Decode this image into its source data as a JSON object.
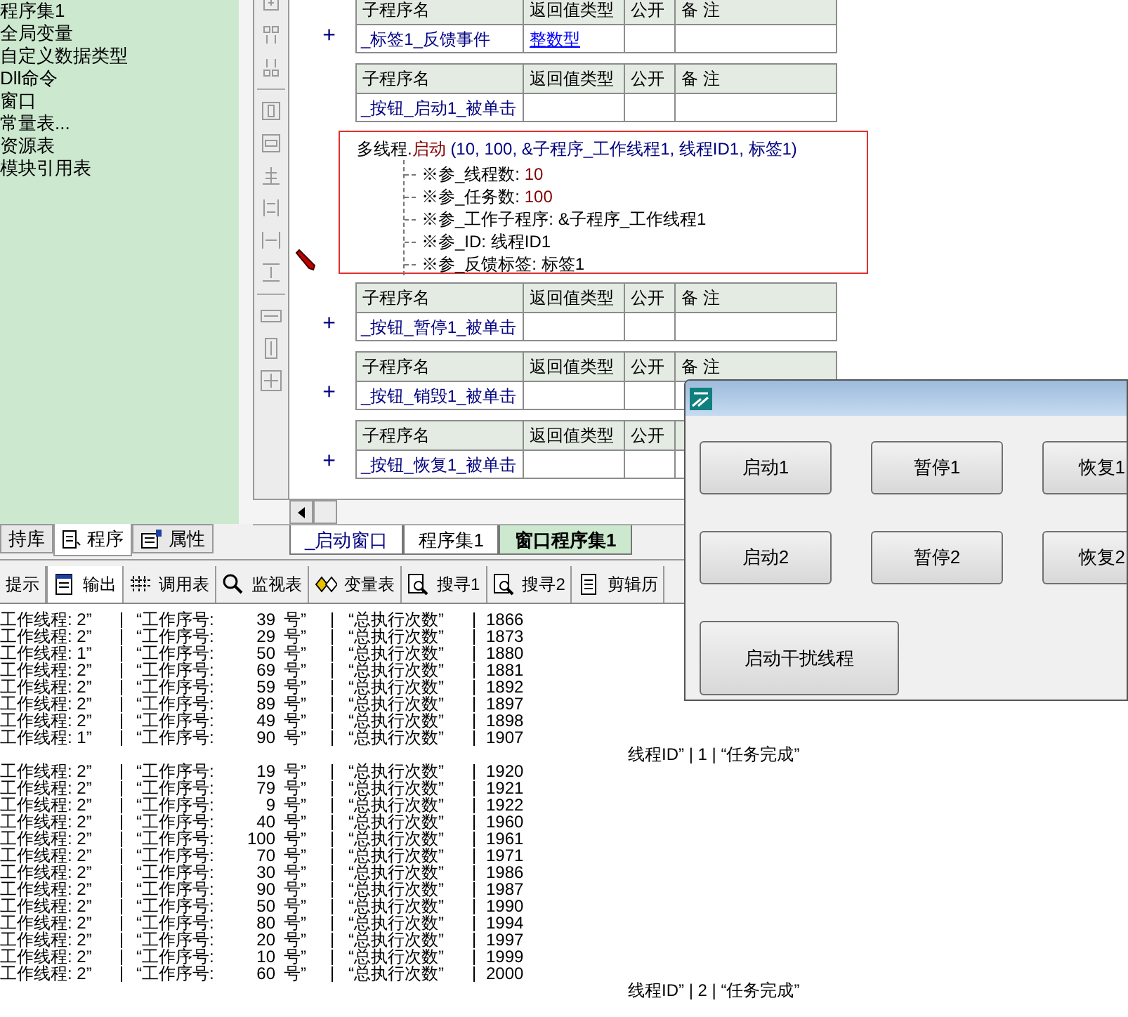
{
  "project_tree": {
    "items": [
      "程序集1",
      "全局变量",
      "自定义数据类型",
      "Dll命令",
      "窗口",
      "常量表...",
      "资源表",
      "模块引用表"
    ]
  },
  "left_tabs": [
    {
      "label": "持库",
      "selected": false
    },
    {
      "label": "程序",
      "selected": true
    },
    {
      "label": "属性",
      "selected": false
    }
  ],
  "code": {
    "blocks": [
      {
        "kind": "subroutine",
        "headers": [
          "子程序名",
          "返回值类型",
          "公开",
          "备 注"
        ],
        "name": "_标签1_反馈事件",
        "return_type": "整数型",
        "expanded": false,
        "marker": "+"
      },
      {
        "kind": "subroutine",
        "headers": [
          "子程序名",
          "返回值类型",
          "公开",
          "备 注"
        ],
        "name": "_按钮_启动1_被单击"
      },
      {
        "kind": "call",
        "object": "多线程.",
        "method": "启动",
        "args": "(10, 100, &子程序_工作线程1, 线程ID1, 标签1)",
        "highlighted": true,
        "current": true,
        "params": [
          {
            "name": "※参_线程数:",
            "value": "10",
            "kind": "constant"
          },
          {
            "name": "※参_任务数:",
            "value": "100",
            "kind": "constant"
          },
          {
            "name": "※参_工作子程序:",
            "value": "&子程序_工作线程1",
            "kind": "reference"
          },
          {
            "name": "※参_ID:",
            "value": "线程ID1",
            "kind": "reference"
          },
          {
            "name": "※参_反馈标签:",
            "value": "标签1",
            "kind": "reference"
          }
        ]
      },
      {
        "kind": "subroutine",
        "headers": [
          "子程序名",
          "返回值类型",
          "公开",
          "备 注"
        ],
        "name": "_按钮_暂停1_被单击",
        "expanded": false,
        "marker": "+"
      },
      {
        "kind": "subroutine",
        "headers": [
          "子程序名",
          "返回值类型",
          "公开",
          "备 注"
        ],
        "name": "_按钮_销毁1_被单击",
        "expanded": false,
        "marker": "+"
      },
      {
        "kind": "subroutine",
        "headers": [
          "子程序名",
          "返回值类型",
          "公开"
        ],
        "name": "_按钮_恢复1_被单击",
        "expanded": false,
        "marker": "+"
      }
    ]
  },
  "code_tabs": [
    {
      "label": "_启动窗口",
      "kind": "window",
      "selected": false
    },
    {
      "label": "程序集1",
      "kind": "module",
      "selected": false
    },
    {
      "label": "窗口程序集1",
      "kind": "module",
      "selected": true
    }
  ],
  "output_tabs": [
    {
      "label": "提示",
      "selected": false
    },
    {
      "label": "输出",
      "selected": true
    },
    {
      "label": "调用表",
      "selected": false
    },
    {
      "label": "监视表",
      "selected": false
    },
    {
      "label": "变量表",
      "selected": false
    },
    {
      "label": "搜寻1",
      "selected": false
    },
    {
      "label": "搜寻2",
      "selected": false
    },
    {
      "label": "剪辑历",
      "selected": false
    }
  ],
  "output_lines": [
    {
      "kind": "record",
      "thread": "工作线程: 2”",
      "seq": "“工作序号:",
      "number": "39",
      "unit": "号”",
      "total": "“总执行次数”",
      "count": "1866"
    },
    {
      "kind": "record",
      "thread": "工作线程: 2”",
      "seq": "“工作序号:",
      "number": "29",
      "unit": "号”",
      "total": "“总执行次数”",
      "count": "1873"
    },
    {
      "kind": "record",
      "thread": "工作线程: 1”",
      "seq": "“工作序号:",
      "number": "50",
      "unit": "号”",
      "total": "“总执行次数”",
      "count": "1880"
    },
    {
      "kind": "record",
      "thread": "工作线程: 2”",
      "seq": "“工作序号:",
      "number": "69",
      "unit": "号”",
      "total": "“总执行次数”",
      "count": "1881"
    },
    {
      "kind": "record",
      "thread": "工作线程: 2”",
      "seq": "“工作序号:",
      "number": "59",
      "unit": "号”",
      "total": "“总执行次数”",
      "count": "1892"
    },
    {
      "kind": "record",
      "thread": "工作线程: 2”",
      "seq": "“工作序号:",
      "number": "89",
      "unit": "号”",
      "total": "“总执行次数”",
      "count": "1897"
    },
    {
      "kind": "record",
      "thread": "工作线程: 2”",
      "seq": "“工作序号:",
      "number": "49",
      "unit": "号”",
      "total": "“总执行次数”",
      "count": "1898"
    },
    {
      "kind": "record",
      "thread": "工作线程: 1”",
      "seq": "“工作序号:",
      "number": "90",
      "unit": "号”",
      "total": "“总执行次数”",
      "count": "1907"
    },
    {
      "kind": "done",
      "text": "线程ID” | 1 | “任务完成”"
    },
    {
      "kind": "record",
      "thread": "工作线程: 2”",
      "seq": "“工作序号:",
      "number": "19",
      "unit": "号”",
      "total": "“总执行次数”",
      "count": "1920"
    },
    {
      "kind": "record",
      "thread": "工作线程: 2”",
      "seq": "“工作序号:",
      "number": "79",
      "unit": "号”",
      "total": "“总执行次数”",
      "count": "1921"
    },
    {
      "kind": "record",
      "thread": "工作线程: 2”",
      "seq": "“工作序号:",
      "number": "9",
      "unit": "号”",
      "total": "“总执行次数”",
      "count": "1922"
    },
    {
      "kind": "record",
      "thread": "工作线程: 2”",
      "seq": "“工作序号:",
      "number": "40",
      "unit": "号”",
      "total": "“总执行次数”",
      "count": "1960"
    },
    {
      "kind": "record",
      "thread": "工作线程: 2”",
      "seq": "“工作序号:",
      "number": "100",
      "unit": "号”",
      "total": "“总执行次数”",
      "count": "1961"
    },
    {
      "kind": "record",
      "thread": "工作线程: 2”",
      "seq": "“工作序号:",
      "number": "70",
      "unit": "号”",
      "total": "“总执行次数”",
      "count": "1971"
    },
    {
      "kind": "record",
      "thread": "工作线程: 2”",
      "seq": "“工作序号:",
      "number": "30",
      "unit": "号”",
      "total": "“总执行次数”",
      "count": "1986"
    },
    {
      "kind": "record",
      "thread": "工作线程: 2”",
      "seq": "“工作序号:",
      "number": "90",
      "unit": "号”",
      "total": "“总执行次数”",
      "count": "1987"
    },
    {
      "kind": "record",
      "thread": "工作线程: 2”",
      "seq": "“工作序号:",
      "number": "50",
      "unit": "号”",
      "total": "“总执行次数”",
      "count": "1990"
    },
    {
      "kind": "record",
      "thread": "工作线程: 2”",
      "seq": "“工作序号:",
      "number": "80",
      "unit": "号”",
      "total": "“总执行次数”",
      "count": "1994"
    },
    {
      "kind": "record",
      "thread": "工作线程: 2”",
      "seq": "“工作序号:",
      "number": "20",
      "unit": "号”",
      "total": "“总执行次数”",
      "count": "1997"
    },
    {
      "kind": "record",
      "thread": "工作线程: 2”",
      "seq": "“工作序号:",
      "number": "10",
      "unit": "号”",
      "total": "“总执行次数”",
      "count": "1999"
    },
    {
      "kind": "record",
      "thread": "工作线程: 2”",
      "seq": "“工作序号:",
      "number": "60",
      "unit": "号”",
      "total": "“总执行次数”",
      "count": "2000"
    },
    {
      "kind": "done",
      "text": "线程ID” | 2 | “任务完成”"
    }
  ],
  "dialog": {
    "buttons": [
      "启动1",
      "暂停1",
      "恢复1",
      "启动2",
      "暂停2",
      "恢复2",
      "启动干扰线程"
    ]
  }
}
